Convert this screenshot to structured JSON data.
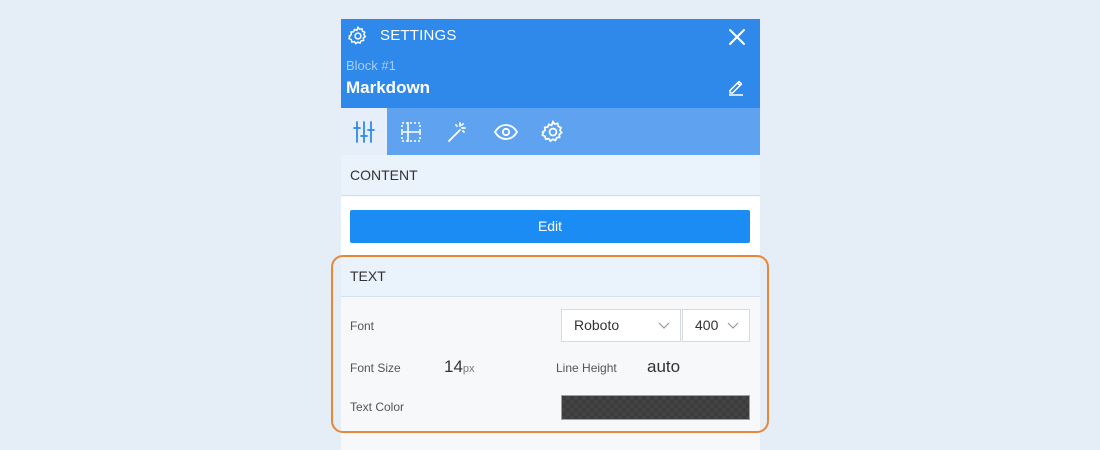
{
  "header": {
    "title": "SETTINGS",
    "block_id": "Block #1",
    "block_name": "Markdown"
  },
  "tabs": [
    {
      "icon": "sliders-icon",
      "active": true
    },
    {
      "icon": "layout-grid-icon",
      "active": false
    },
    {
      "icon": "magic-wand-icon",
      "active": false
    },
    {
      "icon": "eye-icon",
      "active": false
    },
    {
      "icon": "gear-icon",
      "active": false
    }
  ],
  "content_section": {
    "title": "CONTENT",
    "edit_label": "Edit"
  },
  "text_section": {
    "title": "TEXT",
    "font_label": "Font",
    "font_family": "Roboto",
    "font_weight": "400",
    "font_size_label": "Font Size",
    "font_size_value": "14",
    "font_size_unit": "px",
    "line_height_label": "Line Height",
    "line_height_value": "auto",
    "text_color_label": "Text Color"
  },
  "colors": {
    "header_bg": "#2e89ea",
    "tabs_bg": "#5fa3f0",
    "primary_button": "#1b8cf3",
    "highlight": "#e8873a",
    "text_color_swatch": "#3c3c3c"
  }
}
